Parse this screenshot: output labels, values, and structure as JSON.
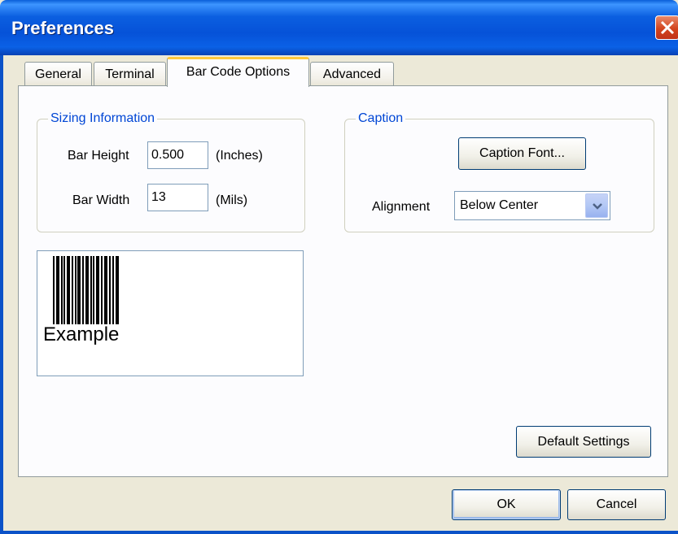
{
  "window": {
    "title": "Preferences"
  },
  "tabs": [
    {
      "label": "General"
    },
    {
      "label": "Terminal"
    },
    {
      "label": "Bar Code Options"
    },
    {
      "label": "Advanced"
    }
  ],
  "active_tab": "Bar Code Options",
  "sizing": {
    "group_label": "Sizing Information",
    "bar_height": {
      "label": "Bar Height",
      "value": "0.500",
      "unit": "(Inches)"
    },
    "bar_width": {
      "label": "Bar Width",
      "value": "13",
      "unit": "(Mils)"
    }
  },
  "caption": {
    "group_label": "Caption",
    "font_button": "Caption Font...",
    "alignment_label": "Alignment",
    "alignment_value": "Below Center"
  },
  "preview": {
    "caption": "Example"
  },
  "buttons": {
    "default_settings": "Default Settings",
    "ok": "OK",
    "cancel": "Cancel"
  },
  "colors": {
    "titlebar": "#0b5fe0",
    "accent_tab": "#ffc83c",
    "group_title": "#0046d5"
  },
  "icons": {
    "close": "close-icon",
    "dropdown": "chevron-down-icon"
  }
}
